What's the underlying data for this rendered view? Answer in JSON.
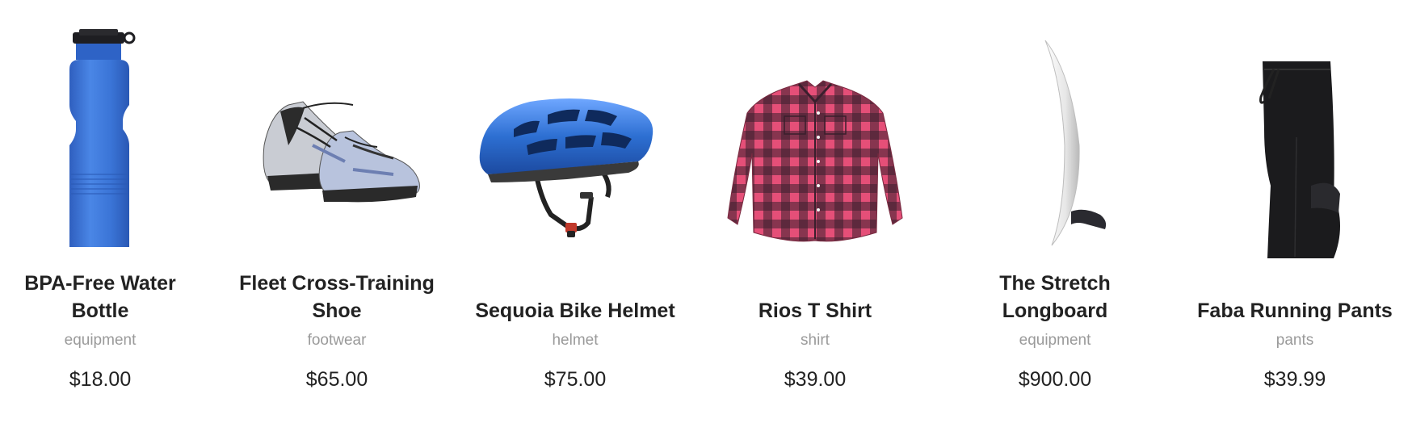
{
  "products": [
    {
      "name": "BPA-Free Water Bottle",
      "category": "equipment",
      "price": "$18.00",
      "icon": "water-bottle-image"
    },
    {
      "name": "Fleet Cross-Training Shoe",
      "category": "footwear",
      "price": "$65.00",
      "icon": "sneakers-image"
    },
    {
      "name": "Sequoia Bike Helmet",
      "category": "helmet",
      "price": "$75.00",
      "icon": "bike-helmet-image"
    },
    {
      "name": "Rios T Shirt",
      "category": "shirt",
      "price": "$39.00",
      "icon": "plaid-shirt-image"
    },
    {
      "name": "The Stretch Longboard",
      "category": "equipment",
      "price": "$900.00",
      "icon": "longboard-image"
    },
    {
      "name": "Faba Running Pants",
      "category": "pants",
      "price": "$39.99",
      "icon": "running-pants-image"
    }
  ],
  "colors": {
    "bottle_blue": "#3a74d6",
    "helmet_blue": "#2d6fd2",
    "shirt_pink": "#e54f78",
    "shirt_dark": "#3a1f2d",
    "pants_black": "#1b1b1d",
    "text_dark": "#222222",
    "text_muted": "#9a9a9a"
  }
}
